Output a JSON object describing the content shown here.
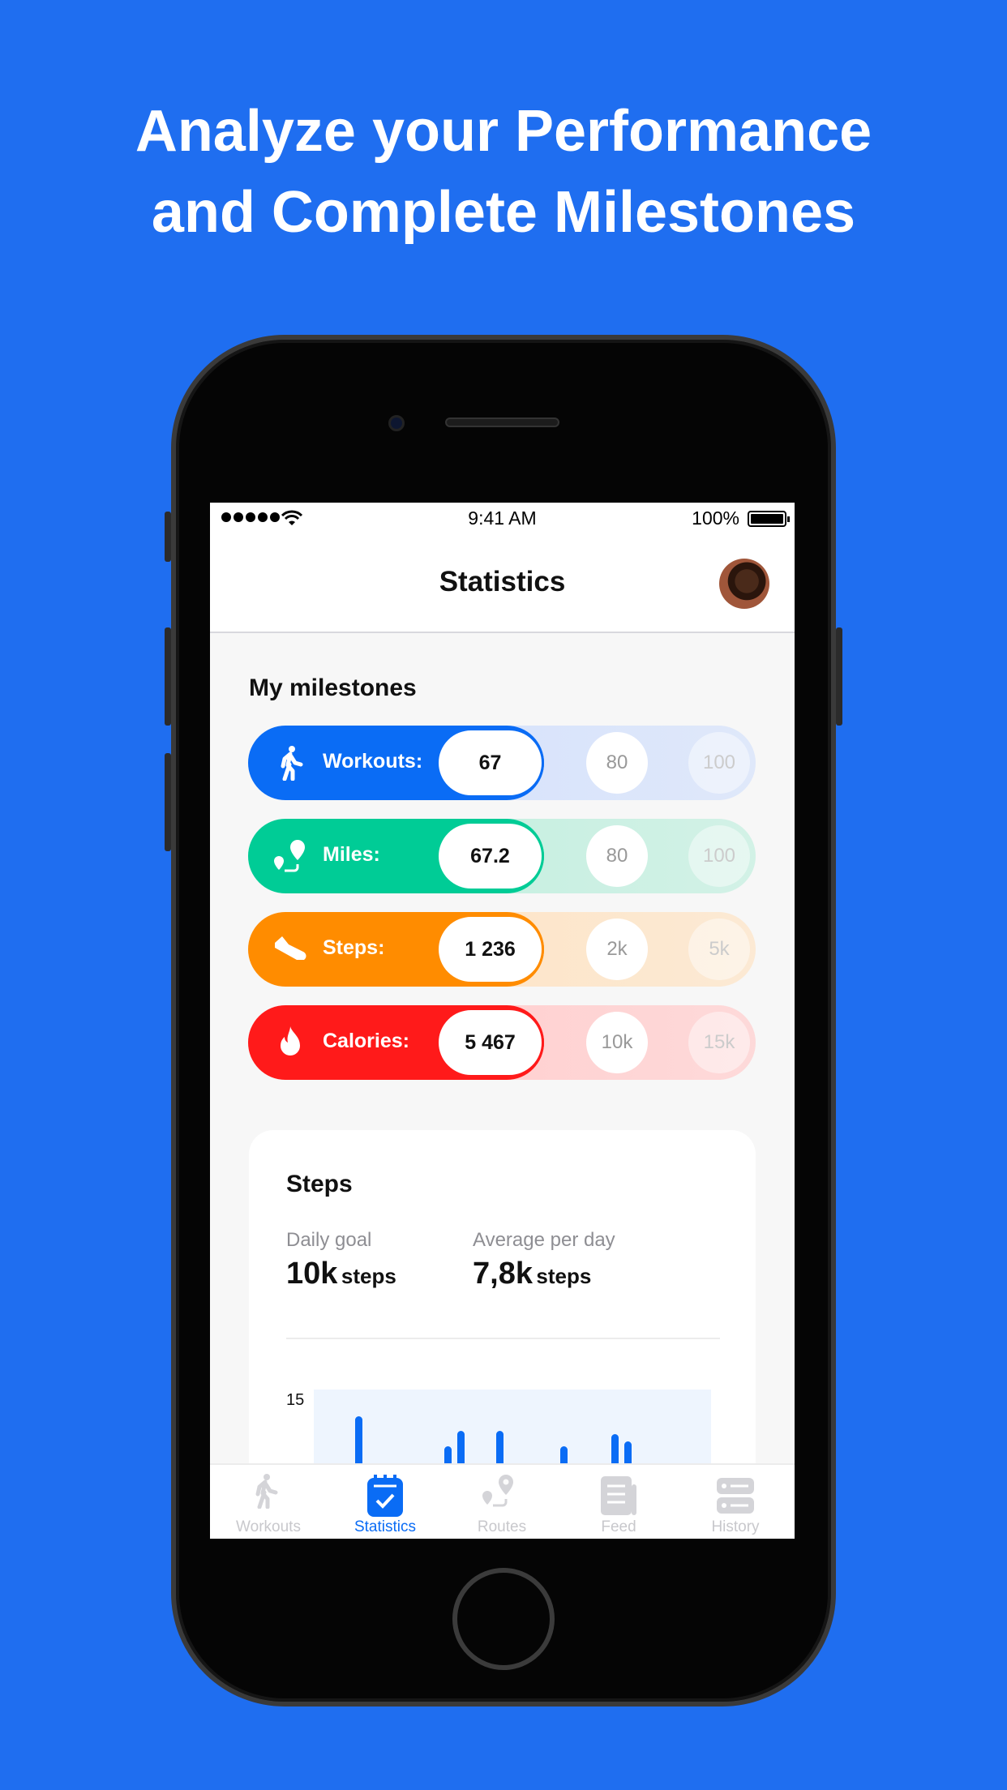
{
  "headline": {
    "line1": "Analyze your Performance",
    "line2": "and Complete Milestones"
  },
  "colors": {
    "background": "#1f6ef0",
    "accent": "#0a6cf5"
  },
  "status_bar": {
    "time": "9:41 AM",
    "battery": "100%",
    "signal_icon": "signal-dots-icon",
    "wifi_icon": "wifi-icon",
    "battery_icon": "battery-icon"
  },
  "header": {
    "title": "Statistics",
    "avatar": "user-avatar"
  },
  "milestones": {
    "title": "My milestones",
    "rows": [
      {
        "label": "Workouts:",
        "value": "67",
        "next": "80",
        "goal": "100",
        "icon": "walking-icon",
        "color": "#0a6cf5",
        "track": "#d9e4fb"
      },
      {
        "label": "Miles:",
        "value": "67.2",
        "next": "80",
        "goal": "100",
        "icon": "route-icon",
        "color": "#00cc96",
        "track": "#c9f0e2"
      },
      {
        "label": "Steps:",
        "value": "1 236",
        "next": "2k",
        "goal": "5k",
        "icon": "sneaker-icon",
        "color": "#ff8c00",
        "track": "#fde6cb"
      },
      {
        "label": "Calories:",
        "value": "5 467",
        "next": "10k",
        "goal": "15k",
        "icon": "flame-icon",
        "color": "#ff1a1a",
        "track": "#ffd2d2"
      }
    ]
  },
  "steps_card": {
    "title": "Steps",
    "daily_goal_label": "Daily goal",
    "daily_goal_value": "10k",
    "daily_goal_unit": "steps",
    "average_label": "Average per day",
    "average_value": "7,8k",
    "average_unit": "steps"
  },
  "chart_data": {
    "type": "bar",
    "title": "",
    "y_ticks_visible": [
      "15"
    ],
    "ylim": [
      0,
      15
    ],
    "grid": false,
    "values": [
      0,
      0,
      0,
      13.5,
      0,
      0,
      0,
      0,
      0,
      0,
      11.8,
      12.7,
      0,
      0,
      12.7,
      0,
      0,
      0,
      0,
      11.8,
      0,
      0,
      0,
      12.5,
      12.1,
      0,
      0,
      0,
      0,
      0,
      0
    ],
    "color": "#0a6cf5"
  },
  "tabs": [
    {
      "label": "Workouts",
      "icon": "walking-icon",
      "active": false
    },
    {
      "label": "Statistics",
      "icon": "calendar-check-icon",
      "active": true
    },
    {
      "label": "Routes",
      "icon": "route-icon",
      "active": false
    },
    {
      "label": "Feed",
      "icon": "newspaper-icon",
      "active": false
    },
    {
      "label": "History",
      "icon": "list-icon",
      "active": false
    }
  ]
}
